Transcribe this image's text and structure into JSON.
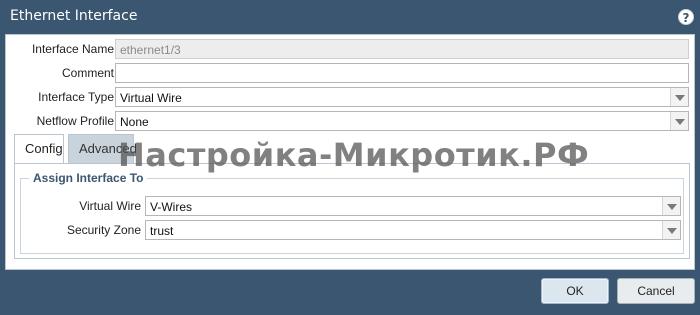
{
  "window": {
    "title": "Ethernet Interface",
    "help_icon": "?"
  },
  "fields": {
    "interface_name": {
      "label": "Interface Name",
      "value": "ethernet1/3"
    },
    "comment": {
      "label": "Comment",
      "value": ""
    },
    "interface_type": {
      "label": "Interface Type",
      "value": "Virtual Wire"
    },
    "netflow_profile": {
      "label": "Netflow Profile",
      "value": "None"
    }
  },
  "tabs": [
    {
      "label": "Config",
      "active": true
    },
    {
      "label": "Advanced",
      "active": false
    }
  ],
  "assign_group": {
    "title": "Assign Interface To",
    "virtual_wire": {
      "label": "Virtual Wire",
      "value": "V-Wires"
    },
    "security_zone": {
      "label": "Security Zone",
      "value": "trust"
    }
  },
  "watermark": "Настройка-Микротик.РФ",
  "buttons": {
    "ok": "OK",
    "cancel": "Cancel"
  },
  "colors": {
    "frame": "#3b5670",
    "ok_bg": "#dbe6ef",
    "group_title": "#3b5670"
  }
}
